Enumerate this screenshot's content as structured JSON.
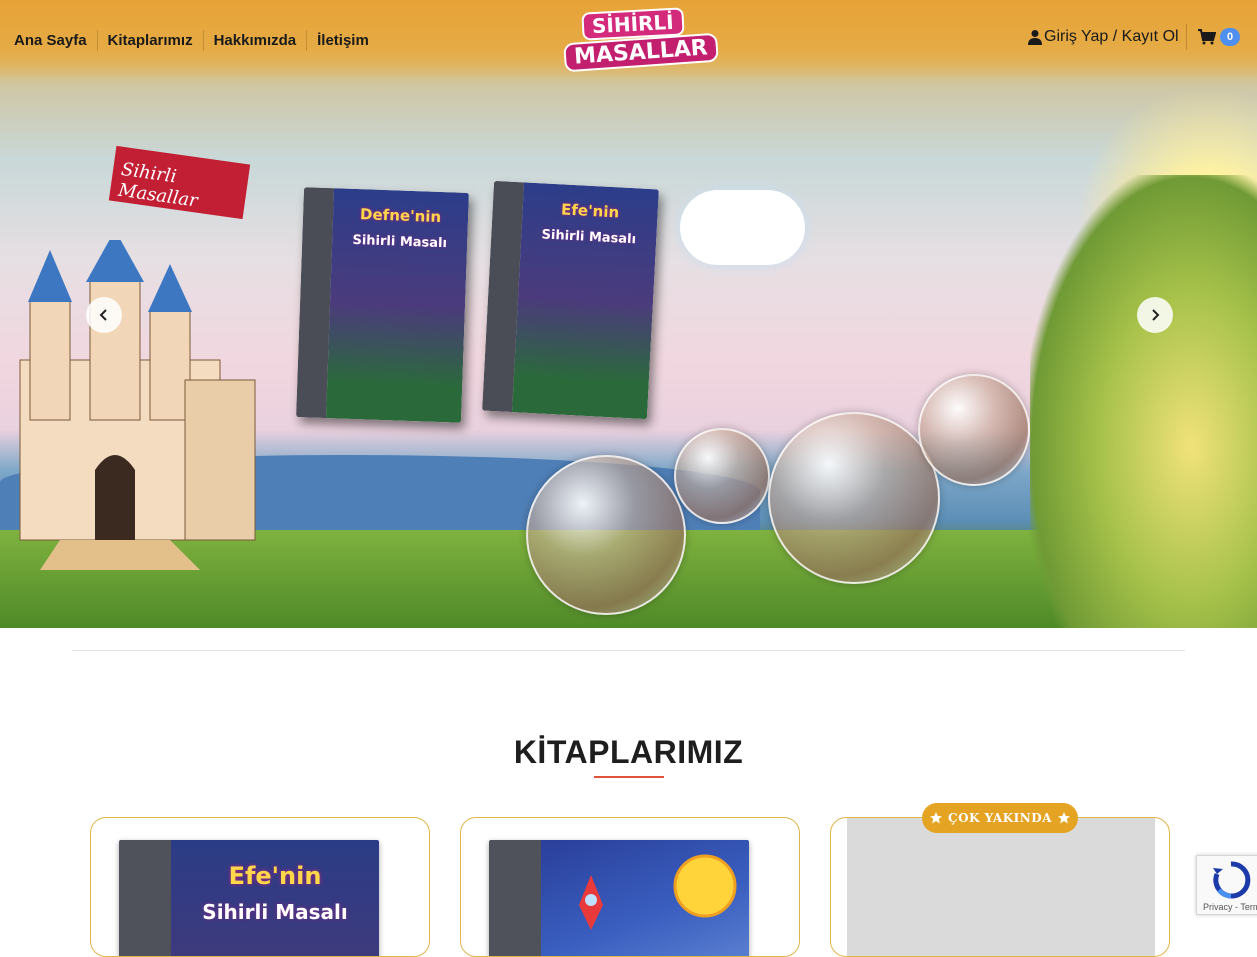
{
  "nav": {
    "links": [
      "Ana Sayfa",
      "Kitaplarımız",
      "Hakkımızda",
      "İletişim"
    ],
    "logo_line1": "SİHİRLİ",
    "logo_line2": "MASALLAR",
    "login_label": "Giriş Yap / Kayıt Ol",
    "cart_count": "0"
  },
  "hero": {
    "castle_flag_text": "Sihirli Masallar",
    "books": [
      {
        "title": "Defne'nin",
        "subtitle": "Sihirli Masalı"
      },
      {
        "title": "Efe'nin",
        "subtitle": "Sihirli Masalı"
      }
    ]
  },
  "section": {
    "title": "KİTAPLARIMIZ"
  },
  "cards": [
    {
      "title": "Efe'nin",
      "subtitle": "Sihirli Masalı"
    },
    {
      "title": "",
      "subtitle": ""
    },
    {
      "badge": "ÇOK YAKINDA"
    }
  ],
  "recaptcha": {
    "footer": "Privacy - Terms"
  },
  "colors": {
    "nav_bg": "#e7a236",
    "accent_underline": "#e0533b",
    "card_border": "#e0b54a",
    "badge_bg": "#e5a324",
    "cart_badge": "#4f8ff0"
  },
  "icons": [
    "user-icon",
    "cart-icon",
    "chevron-left-icon",
    "chevron-right-icon",
    "star-icon"
  ]
}
